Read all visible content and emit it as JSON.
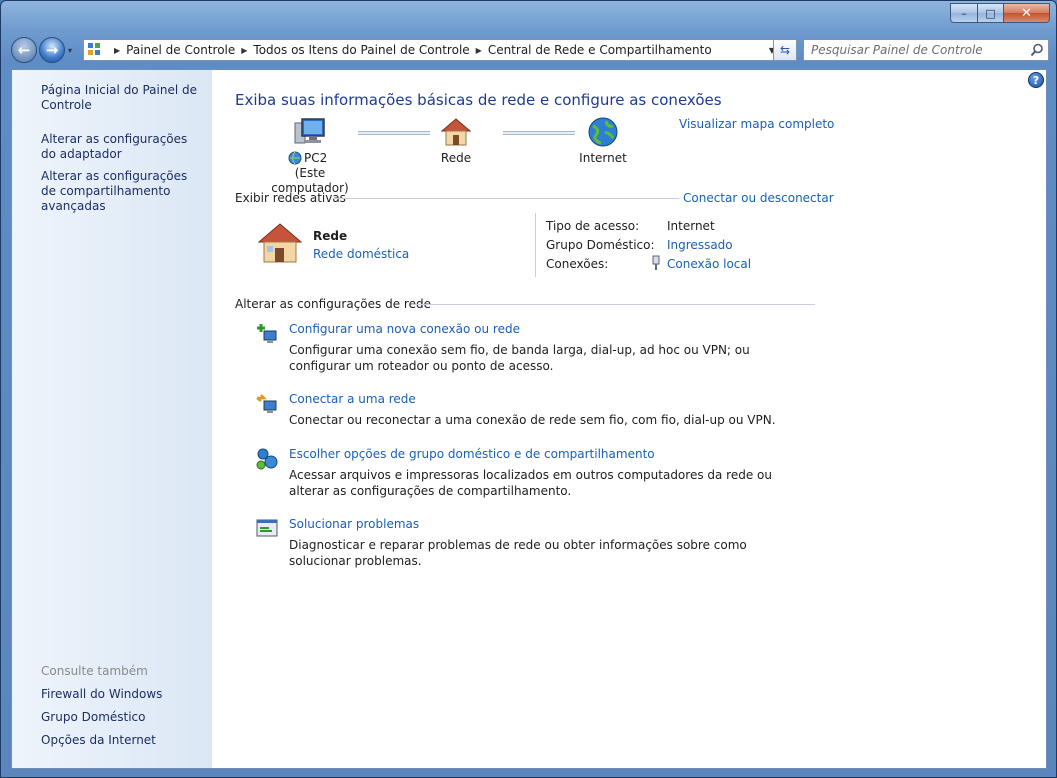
{
  "window": {
    "caption_buttons": {
      "minimize": "–",
      "maximize": "□",
      "close": "✕"
    }
  },
  "nav": {
    "back_icon": "back-arrow-icon",
    "forward_icon": "forward-arrow-icon",
    "recent_dropdown": "▾",
    "breadcrumbs": [
      "Painel de Controle",
      "Todos os Itens do Painel de Controle",
      "Central de Rede e Compartilhamento"
    ],
    "refresh_icon": "refresh-icon",
    "search_placeholder": "Pesquisar Painel de Controle"
  },
  "sidebar": {
    "links": [
      "Página Inicial do Painel de Controle",
      "Alterar as configurações do adaptador",
      "Alterar as configurações de compartilhamento avançadas"
    ],
    "see_also_heading": "Consulte também",
    "see_also": [
      "Firewall do Windows",
      "Grupo Doméstico",
      "Opções da Internet"
    ]
  },
  "main": {
    "title": "Exiba suas informações básicas de rede e configure as conexões",
    "view_full_map": "Visualizar mapa completo",
    "netmap": {
      "computer_name": "PC2",
      "computer_sub": "(Este computador)",
      "network": "Rede",
      "internet": "Internet"
    },
    "active_networks": {
      "heading": "Exibir redes ativas",
      "connect_link": "Conectar ou desconectar",
      "name": "Rede",
      "type": "Rede doméstica",
      "access_label": "Tipo de acesso:",
      "access_value": "Internet",
      "homegroup_label": "Grupo Doméstico:",
      "homegroup_value": "Ingressado",
      "connections_label": "Conexões:",
      "connections_value": "Conexão local"
    },
    "change_settings": {
      "heading": "Alterar as configurações de rede",
      "tasks": [
        {
          "icon": "new-connection-icon",
          "title": "Configurar uma nova conexão ou rede",
          "desc": "Configurar uma conexão sem fio, de banda larga, dial-up, ad hoc ou VPN; ou configurar um roteador ou ponto de acesso."
        },
        {
          "icon": "connect-network-icon",
          "title": "Conectar a uma rede",
          "desc": "Conectar ou reconectar a uma conexão de rede sem fio, com fio, dial-up ou VPN."
        },
        {
          "icon": "homegroup-sharing-icon",
          "title": "Escolher opções de grupo doméstico e de compartilhamento",
          "desc": "Acessar arquivos e impressoras localizados em outros computadores da rede ou alterar as configurações de compartilhamento."
        },
        {
          "icon": "troubleshoot-icon",
          "title": "Solucionar problemas",
          "desc": "Diagnosticar e reparar problemas de rede ou obter informações sobre como solucionar problemas."
        }
      ]
    }
  },
  "help": "?"
}
